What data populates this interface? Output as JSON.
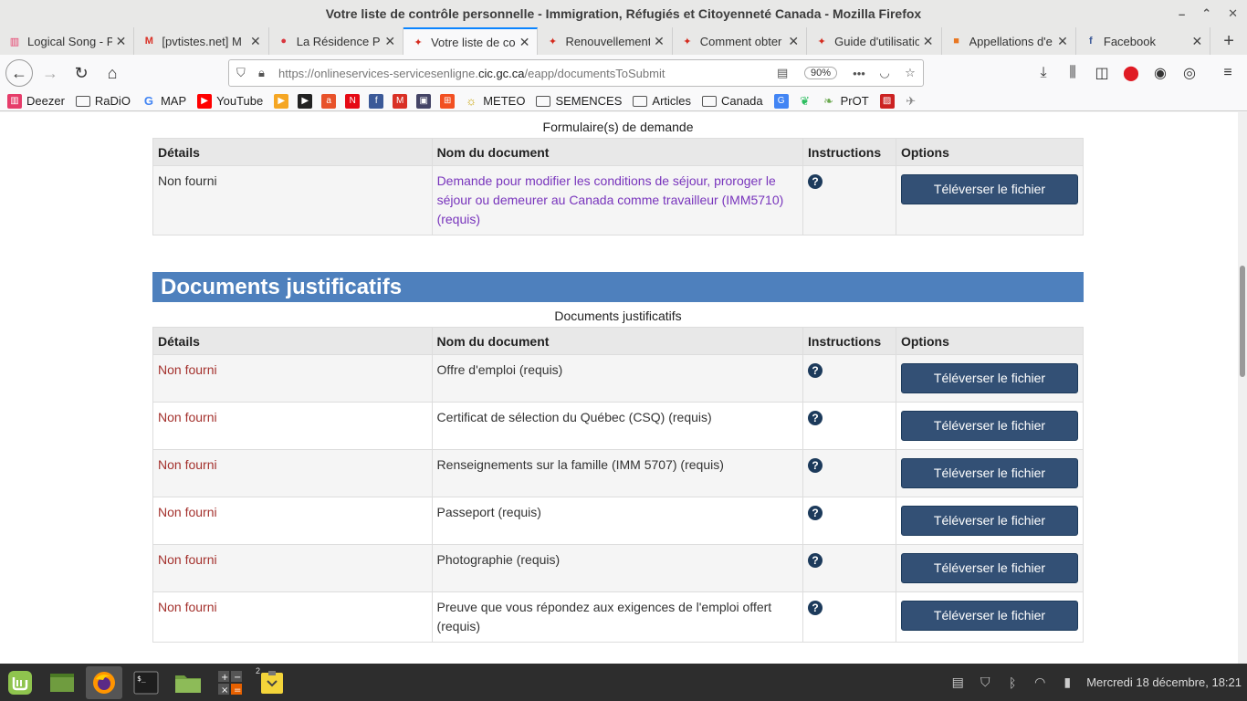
{
  "window": {
    "title": "Votre liste de contrôle personnelle - Immigration, Réfugiés et Citoyenneté Canada - Mozilla Firefox",
    "minimize": "–",
    "restore": "⌃",
    "close": "✕"
  },
  "tabs": [
    {
      "label": "Logical Song - P",
      "icon": "deezer-icon",
      "active": false
    },
    {
      "label": "[pvtistes.net] M",
      "icon": "gmail-icon",
      "active": false
    },
    {
      "label": "La Résidence Pe",
      "icon": "red-pin-icon",
      "active": false
    },
    {
      "label": "Votre liste de co",
      "icon": "maple-leaf-icon",
      "active": true
    },
    {
      "label": "Renouvellement",
      "icon": "maple-leaf-icon",
      "active": false
    },
    {
      "label": "Comment obter",
      "icon": "maple-leaf-icon",
      "active": false
    },
    {
      "label": "Guide d'utilisatio",
      "icon": "maple-leaf-icon",
      "active": false
    },
    {
      "label": "Appellations d'e",
      "icon": "imt-icon",
      "active": false
    },
    {
      "label": "Facebook",
      "icon": "facebook-icon",
      "active": false
    }
  ],
  "tab_close": "✕",
  "new_tab": "+",
  "nav": {
    "url_prefix": "https://onlineservices-servicesenligne.",
    "url_domain": "cic.gc.ca",
    "url_path": "/eapp/documentsToSubmit",
    "zoom": "90%",
    "more": "•••"
  },
  "bookmarks": [
    {
      "label": "Deezer",
      "icon": "deezer-icon",
      "color": "#e63c6a"
    },
    {
      "label": "RaDiO",
      "icon": "folder-icon",
      "color": "#777777"
    },
    {
      "label": "MAP",
      "icon": "google-icon",
      "color": "#4285f4"
    },
    {
      "label": "YouTube",
      "icon": "youtube-icon",
      "color": "#ff0000"
    },
    {
      "label": "",
      "icon": "play-orange-icon",
      "color": "#f5a623"
    },
    {
      "label": "",
      "icon": "play-dark-icon",
      "color": "#222222"
    },
    {
      "label": "",
      "icon": "arte-icon",
      "color": "#e8522a"
    },
    {
      "label": "",
      "icon": "netflix-icon",
      "color": "#e50914"
    },
    {
      "label": "",
      "icon": "facebook-icon",
      "color": "#3b5998"
    },
    {
      "label": "",
      "icon": "gmail-icon",
      "color": "#d93025"
    },
    {
      "label": "",
      "icon": "lock-box-icon",
      "color": "#444466"
    },
    {
      "label": "",
      "icon": "microsoft-icon",
      "color": "#f25022"
    },
    {
      "label": "METEO",
      "icon": "sun-icon",
      "color": "#c8a200"
    },
    {
      "label": "SEMENCES",
      "icon": "folder-icon",
      "color": "#777777"
    },
    {
      "label": "Articles",
      "icon": "folder-icon",
      "color": "#777777"
    },
    {
      "label": "Canada",
      "icon": "folder-icon",
      "color": "#777777"
    },
    {
      "label": "",
      "icon": "translate-icon",
      "color": "#4285f4"
    },
    {
      "label": "",
      "icon": "evernote-icon",
      "color": "#2dbe60"
    },
    {
      "label": "PrOT",
      "icon": "leaf-icon",
      "color": "#6aa84f"
    },
    {
      "label": "",
      "icon": "red-box-icon",
      "color": "#cc2222"
    },
    {
      "label": "",
      "icon": "bird-icon",
      "color": "#888888"
    }
  ],
  "forms_section": {
    "caption": "Formulaire(s) de demande",
    "headers": [
      "Détails",
      "Nom du document",
      "Instructions",
      "Options"
    ],
    "rows": [
      {
        "status": "Non fourni",
        "document": "Demande pour modifier les conditions de séjour, proroger le séjour ou demeurer au Canada comme travailleur (IMM5710) (requis)",
        "help": "?",
        "action": "Téléverser le fichier"
      }
    ]
  },
  "support_section": {
    "title": "Documents justificatifs",
    "caption": "Documents justificatifs",
    "headers": [
      "Détails",
      "Nom du document",
      "Instructions",
      "Options"
    ],
    "rows": [
      {
        "status": "Non fourni",
        "document": "Offre d'emploi  (requis)",
        "help": "?",
        "action": "Téléverser le fichier"
      },
      {
        "status": "Non fourni",
        "document": "Certificat de sélection du Québec (CSQ)  (requis)",
        "help": "?",
        "action": "Téléverser le fichier"
      },
      {
        "status": "Non fourni",
        "document": "Renseignements sur la famille (IMM 5707)  (requis)",
        "help": "?",
        "action": "Téléverser le fichier"
      },
      {
        "status": "Non fourni",
        "document": "Passeport  (requis)",
        "help": "?",
        "action": "Téléverser le fichier"
      },
      {
        "status": "Non fourni",
        "document": "Photographie  (requis)",
        "help": "?",
        "action": "Téléverser le fichier"
      },
      {
        "status": "Non fourni",
        "document": "Preuve que vous répondez aux exigences de l'emploi offert (requis)",
        "help": "?",
        "action": "Téléverser le fichier"
      }
    ]
  },
  "taskbar": {
    "clock": "Mercredi 18 décembre, 18:21",
    "notes_badge": "2"
  },
  "colors": {
    "section_header": "#4e80bd",
    "upload_button": "#335075",
    "status_missing": "#a4312d",
    "doc_link": "#7834bc"
  }
}
